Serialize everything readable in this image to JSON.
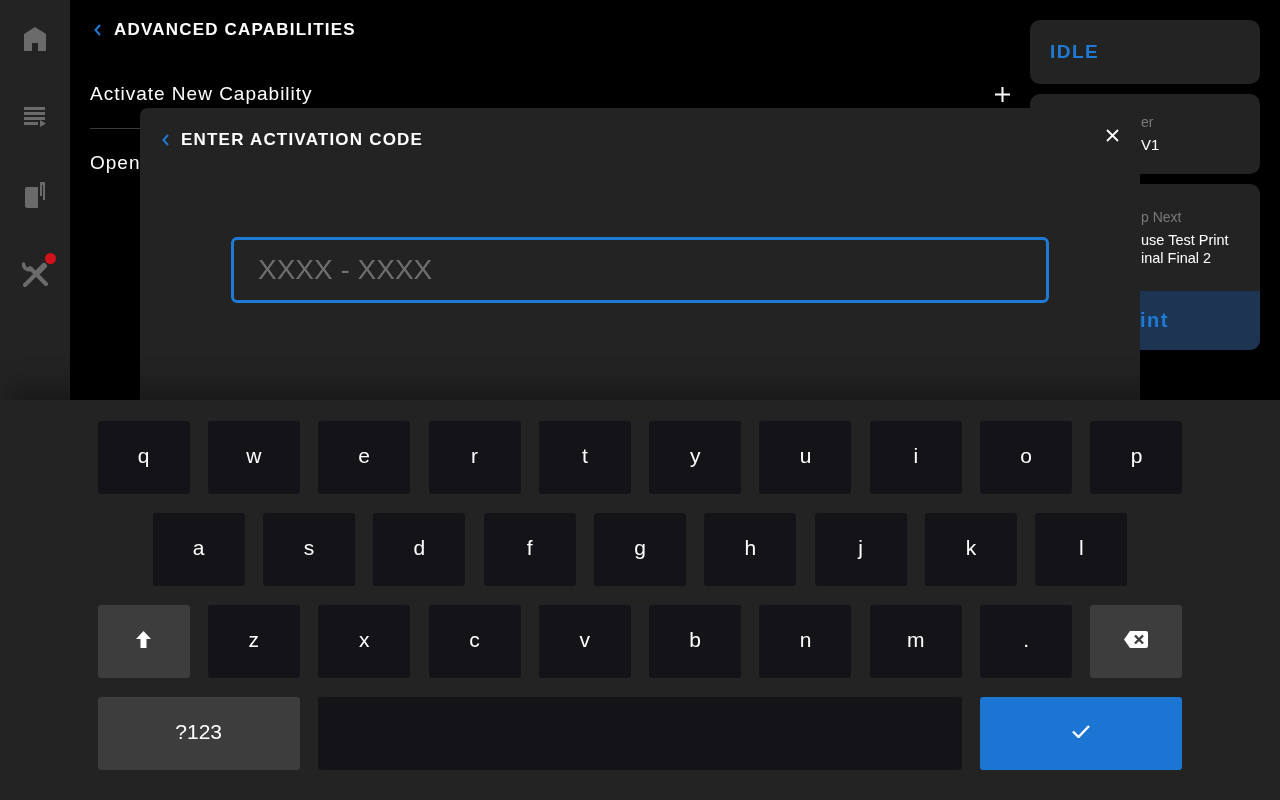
{
  "sidebar": {
    "items": [
      {
        "kind": "home",
        "badge": false
      },
      {
        "kind": "queue",
        "badge": false
      },
      {
        "kind": "printer",
        "badge": false
      },
      {
        "kind": "tools",
        "badge": true
      }
    ]
  },
  "page": {
    "title": "ADVANCED CAPABILITIES",
    "items": [
      {
        "label": "Activate New Capability",
        "kind": "add"
      },
      {
        "label": "Open",
        "kind": "plain"
      }
    ]
  },
  "status_panel": {
    "status": "IDLE",
    "printer_card": {
      "label": "er",
      "value": "V1"
    },
    "up_next_card": {
      "label": "p Next",
      "lines": [
        "use Test Print",
        "inal Final 2"
      ],
      "button": "int"
    }
  },
  "dialog": {
    "title": "ENTER ACTIVATION CODE",
    "input": {
      "placeholder": "XXXX - XXXX"
    }
  },
  "keyboard": {
    "rows": [
      [
        {
          "kind": "char",
          "label": "q"
        },
        {
          "kind": "char",
          "label": "w"
        },
        {
          "kind": "char",
          "label": "e"
        },
        {
          "kind": "char",
          "label": "r"
        },
        {
          "kind": "char",
          "label": "t"
        },
        {
          "kind": "char",
          "label": "y"
        },
        {
          "kind": "char",
          "label": "u"
        },
        {
          "kind": "char",
          "label": "i"
        },
        {
          "kind": "char",
          "label": "o"
        },
        {
          "kind": "char",
          "label": "p"
        }
      ],
      [
        {
          "kind": "char",
          "label": "a"
        },
        {
          "kind": "char",
          "label": "s"
        },
        {
          "kind": "char",
          "label": "d"
        },
        {
          "kind": "char",
          "label": "f"
        },
        {
          "kind": "char",
          "label": "g"
        },
        {
          "kind": "char",
          "label": "h"
        },
        {
          "kind": "char",
          "label": "j"
        },
        {
          "kind": "char",
          "label": "k"
        },
        {
          "kind": "char",
          "label": "l"
        }
      ],
      [
        {
          "kind": "shift"
        },
        {
          "kind": "char",
          "label": "z"
        },
        {
          "kind": "char",
          "label": "x"
        },
        {
          "kind": "char",
          "label": "c"
        },
        {
          "kind": "char",
          "label": "v"
        },
        {
          "kind": "char",
          "label": "b"
        },
        {
          "kind": "char",
          "label": "n"
        },
        {
          "kind": "char",
          "label": "m"
        },
        {
          "kind": "char",
          "label": "."
        },
        {
          "kind": "backspace"
        }
      ],
      [
        {
          "kind": "mode",
          "label": "?123"
        },
        {
          "kind": "space"
        },
        {
          "kind": "enter"
        }
      ]
    ]
  }
}
